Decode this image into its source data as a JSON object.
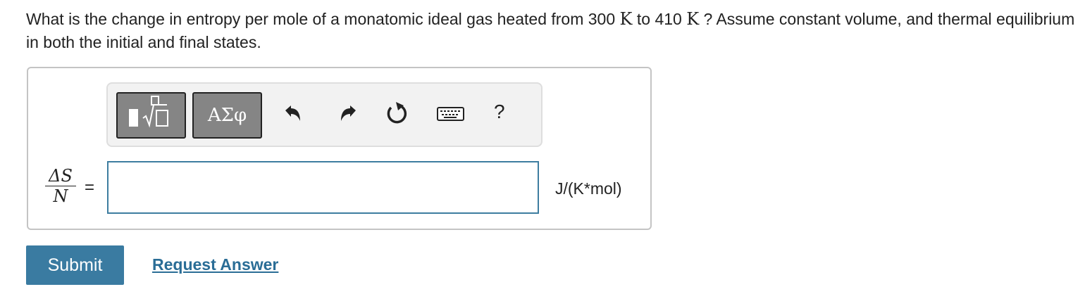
{
  "question": {
    "part1": "What is the change in entropy per mole of a monatomic ideal gas heated from 300",
    "unit1": "K",
    "part2": "to 410",
    "unit2": "K",
    "part3": "? Assume constant volume, and thermal equilibrium in both the initial and final states."
  },
  "toolbar": {
    "symbols_label": "ΑΣφ",
    "help_label": "?",
    "icons": [
      "templates-icon",
      "undo-icon",
      "redo-icon",
      "reset-icon",
      "keyboard-icon",
      "help-icon"
    ]
  },
  "answer": {
    "numerator": "ΔS",
    "denominator": "N",
    "equals": "=",
    "value": "",
    "units": "J/(K*mol)"
  },
  "actions": {
    "submit_label": "Submit",
    "request_label": "Request Answer"
  },
  "colors": {
    "accent": "#3a7ba1",
    "link": "#2a6d96",
    "input_border": "#3d7da0",
    "toolbar_button": "#858585"
  }
}
